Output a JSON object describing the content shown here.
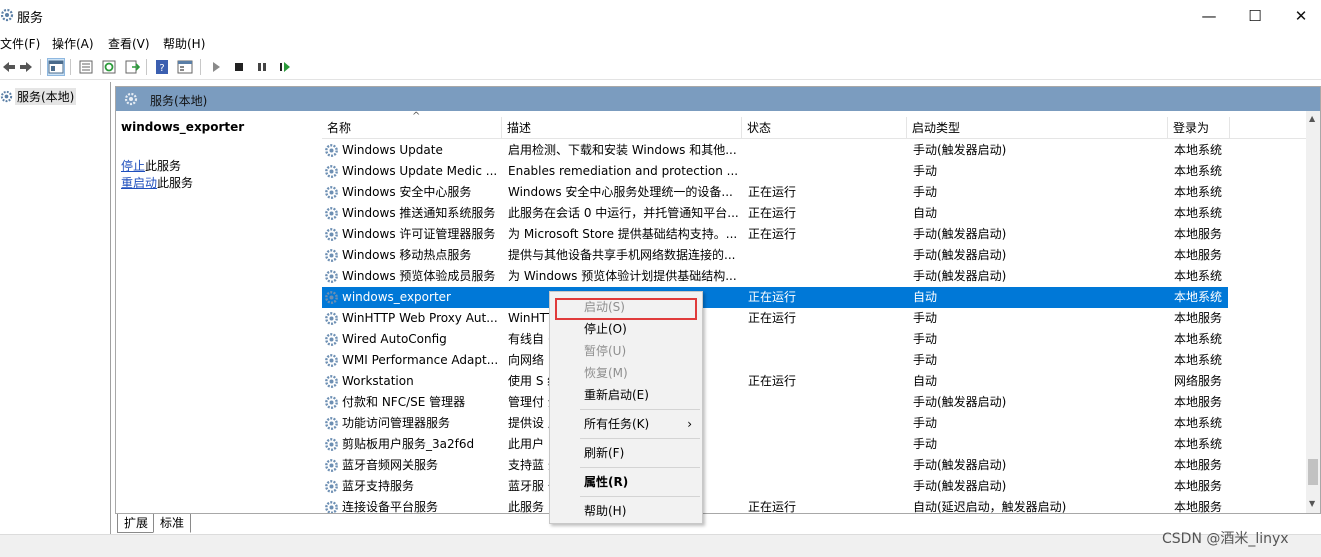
{
  "window": {
    "title": "服务",
    "min": "—",
    "max": "☐",
    "close": "✕"
  },
  "menu": [
    "文件(F)",
    "操作(A)",
    "查看(V)",
    "帮助(H)"
  ],
  "tree": {
    "root": "服务(本地)"
  },
  "panel": {
    "header": "服务(本地)"
  },
  "detail": {
    "service_name": "windows_exporter",
    "stop_link": "停止",
    "stop_suffix": "此服务",
    "restart_link": "重启动",
    "restart_suffix": "此服务"
  },
  "columns": [
    "名称",
    "描述",
    "状态",
    "启动类型",
    "登录为"
  ],
  "rows": [
    {
      "name": "Windows Update",
      "desc": "启用检测、下载和安装 Windows 和其他...",
      "status": "",
      "startup": "手动(触发器启动)",
      "logon": "本地系统"
    },
    {
      "name": "Windows Update Medic ...",
      "desc": "Enables remediation and protection ...",
      "status": "",
      "startup": "手动",
      "logon": "本地系统"
    },
    {
      "name": "Windows 安全中心服务",
      "desc": "Windows 安全中心服务处理统一的设备...",
      "status": "正在运行",
      "startup": "手动",
      "logon": "本地系统"
    },
    {
      "name": "Windows 推送通知系统服务",
      "desc": "此服务在会话 0 中运行，并托管通知平台...",
      "status": "正在运行",
      "startup": "自动",
      "logon": "本地系统"
    },
    {
      "name": "Windows 许可证管理器服务",
      "desc": "为 Microsoft Store 提供基础结构支持。...",
      "status": "正在运行",
      "startup": "手动(触发器启动)",
      "logon": "本地服务"
    },
    {
      "name": "Windows 移动热点服务",
      "desc": "提供与其他设备共享手机网络数据连接的...",
      "status": "",
      "startup": "手动(触发器启动)",
      "logon": "本地服务"
    },
    {
      "name": "Windows 预览体验成员服务",
      "desc": "为 Windows 预览体验计划提供基础结构...",
      "status": "",
      "startup": "手动(触发器启动)",
      "logon": "本地系统"
    },
    {
      "name": "windows_exporter",
      "desc": "",
      "status": "正在运行",
      "startup": "自动",
      "logon": "本地系统",
      "selected": true
    },
    {
      "name": "WinHTTP Web Proxy Aut...",
      "desc": "WinHTT                          并向...",
      "status": "正在运行",
      "startup": "手动",
      "logon": "本地服务"
    },
    {
      "name": "Wired AutoConfig",
      "desc": "有线自                          (以...",
      "status": "",
      "startup": "手动",
      "logon": "本地系统"
    },
    {
      "name": "WMI Performance Adapt...",
      "desc": "向网络                          Mana...",
      "status": "",
      "startup": "手动",
      "logon": "本地系统"
    },
    {
      "name": "Workstation",
      "desc": "使用 S                          络与...",
      "status": "正在运行",
      "startup": "自动",
      "logon": "网络服务"
    },
    {
      "name": "付款和 NFC/SE 管理器",
      "desc": "管理付                          全元...",
      "status": "",
      "startup": "手动(触发器启动)",
      "logon": "本地服务"
    },
    {
      "name": "功能访问管理器服务",
      "desc": "提供设                          用功...",
      "status": "",
      "startup": "手动",
      "logon": "本地系统"
    },
    {
      "name": "剪贴板用户服务_3a2f6d",
      "desc": "此用户",
      "status": "",
      "startup": "手动",
      "logon": "本地系统"
    },
    {
      "name": "蓝牙音频网关服务",
      "desc": "支持蓝                          务。",
      "status": "",
      "startup": "手动(触发器启动)",
      "logon": "本地服务"
    },
    {
      "name": "蓝牙支持服务",
      "desc": "蓝牙服                          备。",
      "status": "",
      "startup": "手动(触发器启动)",
      "logon": "本地服务"
    },
    {
      "name": "连接设备平台服务",
      "desc": "此服务",
      "status": "正在运行",
      "startup": "自动(延迟启动，触发器启动)",
      "logon": "本地服务"
    }
  ],
  "context_menu": {
    "start": "启动(S)",
    "stop": "停止(O)",
    "pause": "暂停(U)",
    "resume": "恢复(M)",
    "restart": "重新启动(E)",
    "all_tasks": "所有任务(K)",
    "refresh": "刷新(F)",
    "properties": "属性(R)",
    "help": "帮助(H)",
    "submenu_arrow": "›"
  },
  "tabs": [
    "扩展",
    "标准"
  ],
  "watermark": "CSDN @酒米_linyx",
  "colors": {
    "selection": "#0078d7",
    "panel_header": "#7b9cbf",
    "highlight_box": "#e03b3b"
  }
}
